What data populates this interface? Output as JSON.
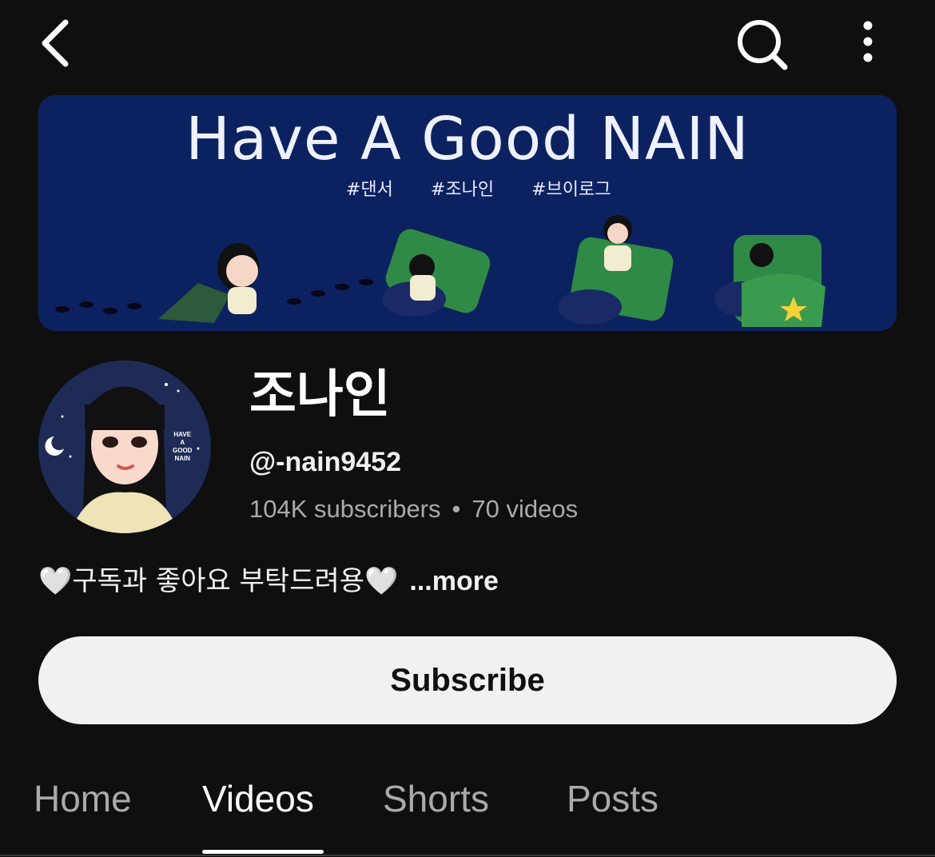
{
  "topbar": {
    "back_icon": "chevron-left-icon",
    "search_icon": "search-icon",
    "more_icon": "more-vertical-icon"
  },
  "banner": {
    "title": "Have A Good NAIN",
    "hashtags": [
      "#댄서",
      "#조나인",
      "#브이로그"
    ],
    "bg_color": "#0c2260"
  },
  "channel": {
    "name": "조나인",
    "handle": "@-nain9452",
    "subscribers": "104K subscribers",
    "separator": "•",
    "videos": "70 videos",
    "avatar_text": [
      "HAVE",
      "A",
      "GOOD",
      "NAIN"
    ]
  },
  "description": {
    "text": "🤍구독과 좋아요 부탁드려용🤍",
    "more_label": "...more"
  },
  "subscribe": {
    "label": "Subscribe"
  },
  "tabs": [
    {
      "label": "Home",
      "active": false
    },
    {
      "label": "Videos",
      "active": true
    },
    {
      "label": "Shorts",
      "active": false
    },
    {
      "label": "Posts",
      "active": false
    }
  ],
  "colors": {
    "background": "#0f0f0f",
    "text_primary": "#f1f1f1",
    "text_secondary": "#aaaaaa",
    "button_bg": "#f1f1f1"
  }
}
